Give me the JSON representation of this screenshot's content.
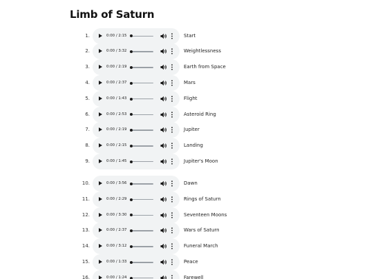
{
  "album": {
    "title": "Limb of Saturn"
  },
  "tracks": [
    {
      "number": "1.",
      "time": "0:00 / 2:15",
      "title": "Start"
    },
    {
      "number": "2.",
      "time": "0:00 / 3:32",
      "title": "Weightlessness"
    },
    {
      "number": "3.",
      "time": "0:00 / 2:19",
      "title": "Earth from Space"
    },
    {
      "number": "4.",
      "time": "0:00 / 2:37",
      "title": "Mars"
    },
    {
      "number": "5.",
      "time": "0:00 / 1:43",
      "title": "Flight"
    },
    {
      "number": "6.",
      "time": "0:00 / 2:53",
      "title": "Asteroid Ring"
    },
    {
      "number": "7.",
      "time": "0:00 / 2:19",
      "title": "Jupiter"
    },
    {
      "number": "8.",
      "time": "0:00 / 2:15",
      "title": "Landing"
    },
    {
      "number": "9.",
      "time": "0:00 / 1:45",
      "title": "Jupiter's Moon"
    },
    {
      "number": "10.",
      "time": "0:00 / 3:56",
      "title": "Dawn"
    },
    {
      "number": "11.",
      "time": "0:00 / 2:29",
      "title": "Rings of Saturn"
    },
    {
      "number": "12.",
      "time": "0:00 / 3:30",
      "title": "Seventeen Moons"
    },
    {
      "number": "13.",
      "time": "0:00 / 2:37",
      "title": "Wars of Saturn"
    },
    {
      "number": "14.",
      "time": "0:00 / 3:12",
      "title": "Funeral March"
    },
    {
      "number": "15.",
      "time": "0:00 / 1:33",
      "title": "Peace"
    },
    {
      "number": "16.",
      "time": "0:00 / 1:24",
      "title": "Farewell"
    }
  ],
  "icons": {
    "play": "play-icon",
    "volume": "volume-icon",
    "more": "more-options-icon"
  },
  "colors": {
    "player_background": "#f1f3f4",
    "icon": "#1a1a1a",
    "progress_track": "#9aa0a6"
  }
}
